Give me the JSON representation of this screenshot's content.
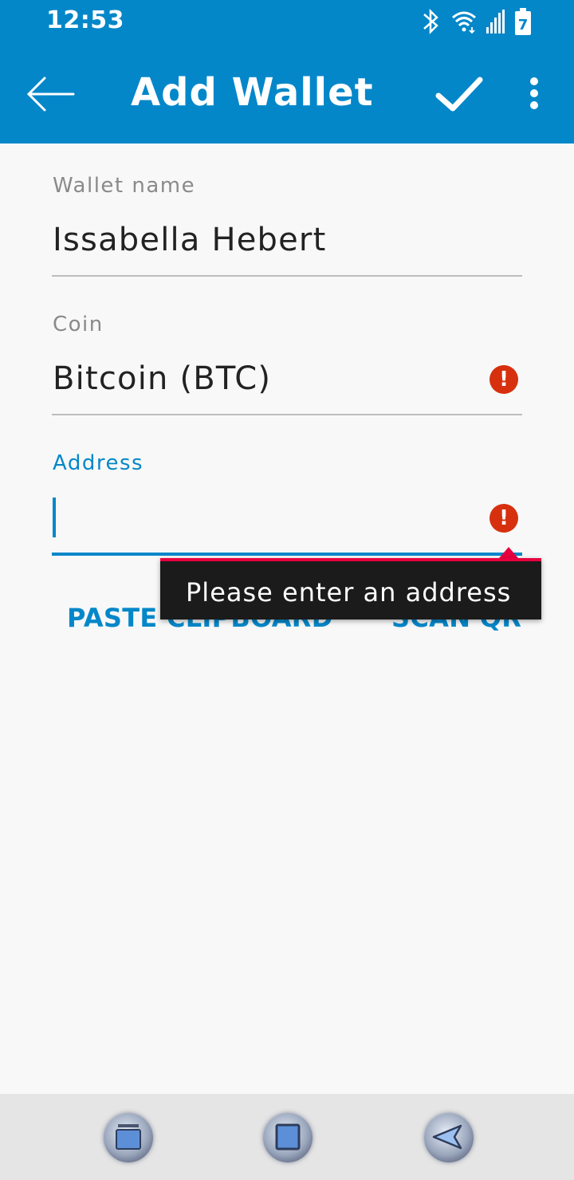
{
  "status_bar": {
    "time": "12:53",
    "icons": [
      "bluetooth-icon",
      "wifi-icon",
      "signal-icon",
      "battery-icon"
    ],
    "battery_level": "7"
  },
  "header": {
    "title": "Add Wallet",
    "back_icon": "arrow-left-icon",
    "confirm_icon": "checkmark-icon",
    "menu_icon": "more-vertical-icon"
  },
  "form": {
    "wallet_name": {
      "label": "Wallet name",
      "value": "Issabella Hebert"
    },
    "coin": {
      "label": "Coin",
      "value": "Bitcoin (BTC)",
      "error_icon": "!"
    },
    "address": {
      "label": "Address",
      "value": "",
      "error_icon": "!"
    }
  },
  "actions": {
    "paste": "PASTE CLIPBOARD",
    "scan": "SCAN QR"
  },
  "tooltip": {
    "message": "Please enter an address"
  },
  "nav": {
    "recent_icon": "recent-apps-icon",
    "home_icon": "home-icon",
    "back_icon": "back-triangle-icon"
  },
  "colors": {
    "primary": "#0487c9",
    "error": "#d7300f",
    "tooltip_bg": "#1b1b1b",
    "tooltip_accent": "#e8003f"
  }
}
